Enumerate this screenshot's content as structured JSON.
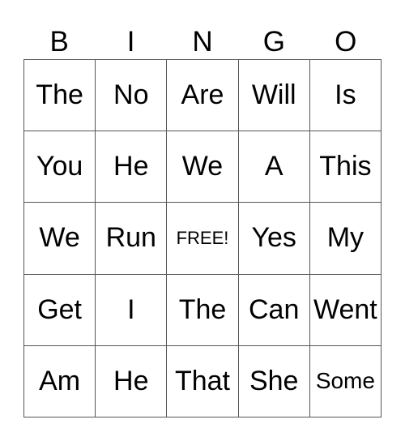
{
  "title_letters": [
    "B",
    "I",
    "N",
    "G",
    "O"
  ],
  "rows": [
    [
      "The",
      "No",
      "Are",
      "Will",
      "Is"
    ],
    [
      "You",
      "He",
      "We",
      "A",
      "This"
    ],
    [
      "We",
      "Run",
      "FREE!",
      "Yes",
      "My"
    ],
    [
      "Get",
      "I",
      "The",
      "Can",
      "Went"
    ],
    [
      "Am",
      "He",
      "That",
      "She",
      "Some"
    ]
  ],
  "free_space_label": "FREE!"
}
